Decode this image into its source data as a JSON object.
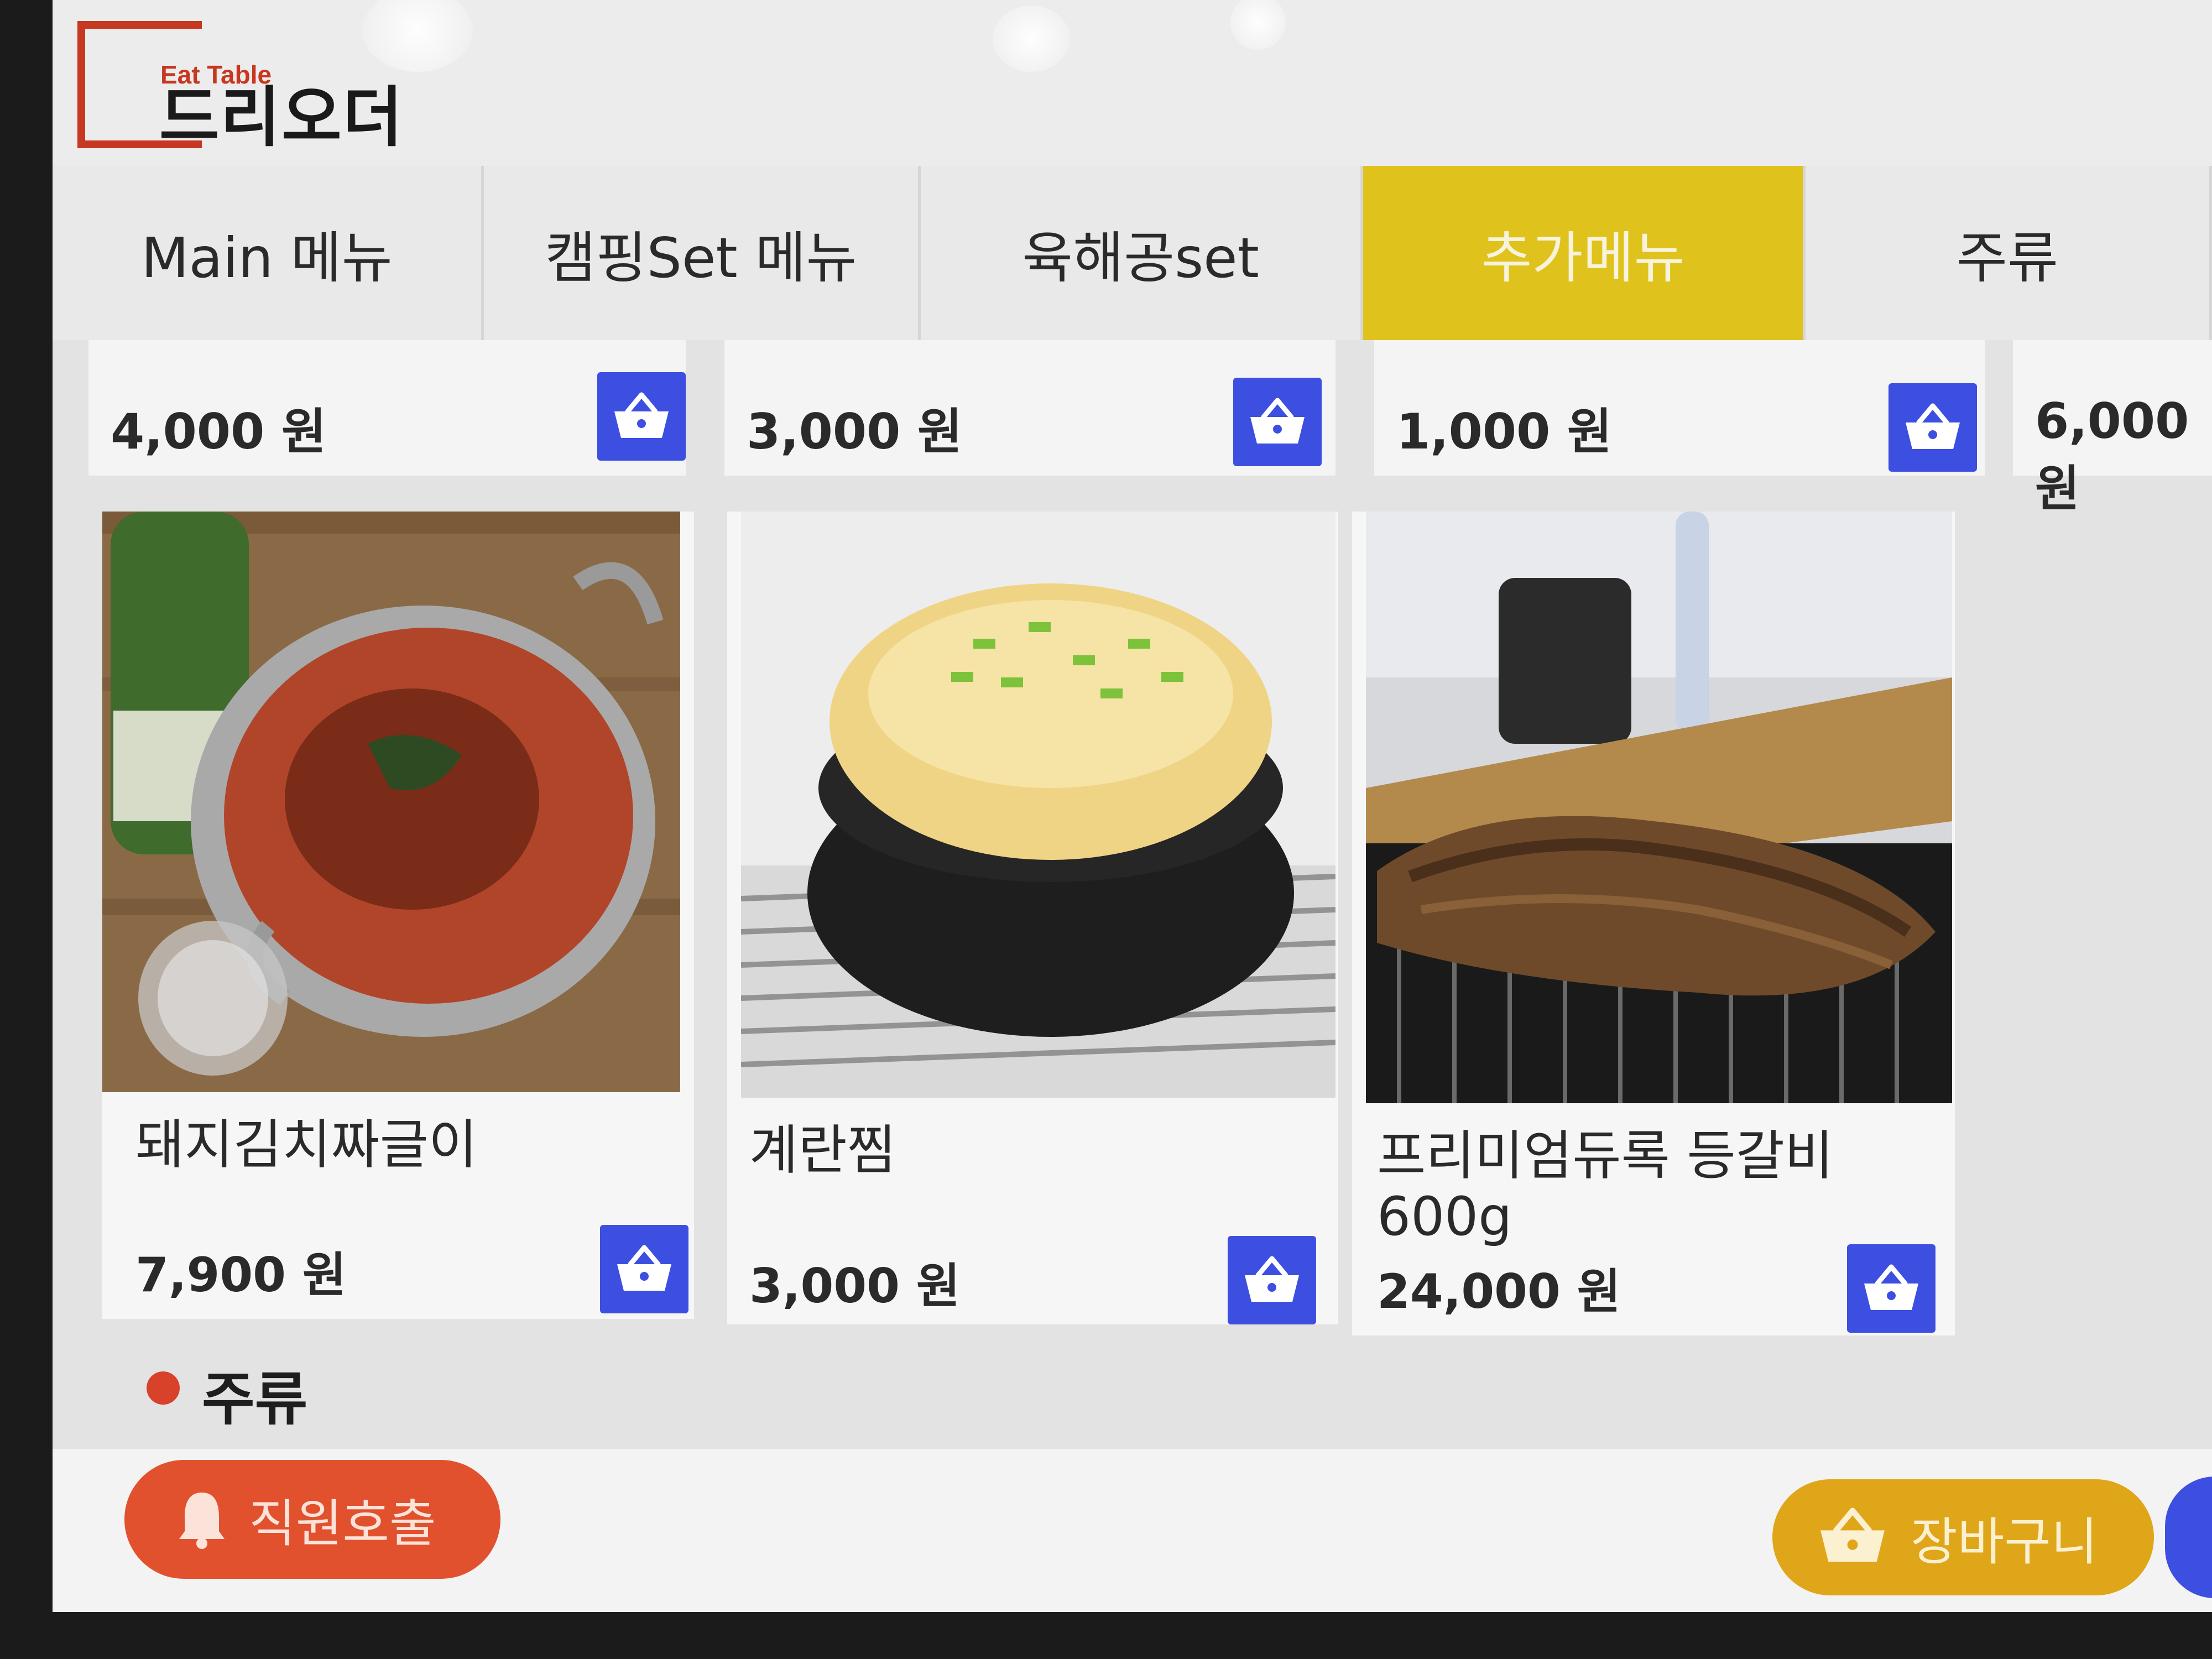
{
  "brand": {
    "tagline": "Eat Table",
    "name": "드리오더"
  },
  "tabs": [
    {
      "label": "Main 메뉴",
      "active": false
    },
    {
      "label": "캠핑Set 메뉴",
      "active": false
    },
    {
      "label": "육해공set",
      "active": false
    },
    {
      "label": "추가메뉴",
      "active": true
    },
    {
      "label": "주류",
      "active": false
    }
  ],
  "top_prices": [
    "4,000 원",
    "3,000 원",
    "1,000 원",
    "6,000 원"
  ],
  "items": [
    {
      "name": "돼지김치짜글이",
      "price": "7,900 원",
      "image": "kimchi-stew-photo"
    },
    {
      "name": "계란찜",
      "price": "3,000 원",
      "image": "steamed-egg-photo"
    },
    {
      "name": "프리미엄듀록 등갈비 600g",
      "price": "24,000 원",
      "image": "pork-ribs-photo"
    }
  ],
  "section": {
    "title": "주류"
  },
  "bottom": {
    "call_label": "직원호출",
    "cart_label": "장바구니"
  },
  "colors": {
    "active_tab": "#e0c21c",
    "cart_button": "#3d4fe0",
    "call_button": "#e2512e",
    "cart_main": "#e0a61a",
    "logo": "#c73820"
  }
}
